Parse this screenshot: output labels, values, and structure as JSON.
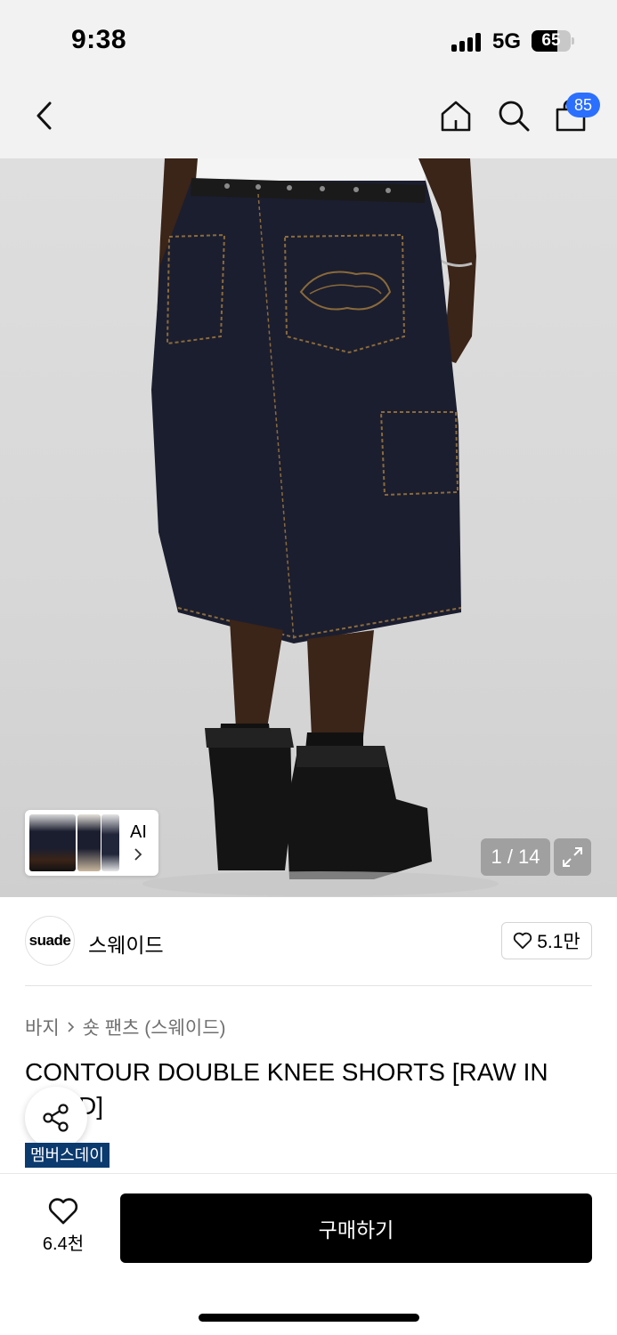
{
  "status_bar": {
    "time": "9:38",
    "network": "5G",
    "battery": "65"
  },
  "nav": {
    "back_icon": "chevron-left-icon",
    "home_icon": "home-icon",
    "search_icon": "search-icon",
    "cart_icon": "shopping-bag-icon",
    "cart_badge": "85",
    "badge_color": "#2b6fff"
  },
  "gallery": {
    "ai_label": "AI",
    "page_counter": "1 / 14",
    "expand_icon": "expand-icon"
  },
  "brand": {
    "logo_text": "suade",
    "name": "스웨이드",
    "like_count": "5.1만"
  },
  "product": {
    "breadcrumb": [
      "바지",
      "숏 팬츠 (스웨이드)"
    ],
    "title_line1": "CONTOUR DOUBLE KNEE SHORTS [RAW IN",
    "title_line2": "  D]",
    "member_badge": "멤버스데이",
    "member_badge_color": "#0b3a6e"
  },
  "bottom_bar": {
    "wish_count": "6.4천",
    "buy_label": "구매하기"
  }
}
